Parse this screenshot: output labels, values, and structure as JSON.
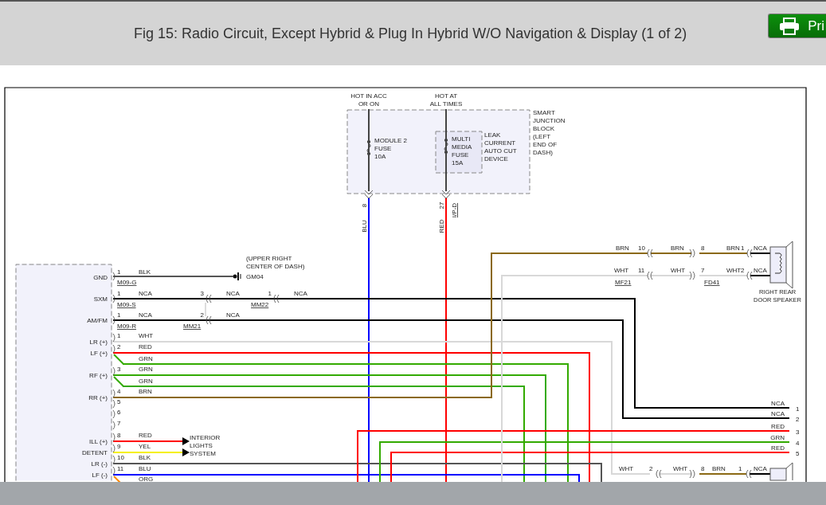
{
  "header": {
    "title": "Fig 15: Radio Circuit, Except Hybrid & Plug In Hybrid W/O Navigation & Display (1 of 2)",
    "print_button": "Pri"
  },
  "feeds": [
    {
      "label": [
        "HOT IN ACC",
        "OR ON"
      ],
      "fuse": [
        "MODULE 2",
        "FUSE",
        "10A"
      ],
      "pin": "8",
      "wire": "BLU",
      "color": "#0000ff"
    },
    {
      "label": [
        "HOT AT",
        "ALL TIMES"
      ],
      "fuse": [
        "MULTI",
        "MEDIA",
        "FUSE",
        "15A"
      ],
      "pin": "27",
      "wire": "RED",
      "color": "#ff0000",
      "connector": "I/P-D"
    }
  ],
  "junction_block": {
    "label": [
      "SMART",
      "JUNCTION",
      "BLOCK",
      "(LEFT",
      "END OF",
      "DASH)"
    ],
    "device": [
      "LEAK",
      "CURRENT",
      "AUTO CUT",
      "DEVICE"
    ]
  },
  "ground": {
    "label": "GND",
    "pin": "1",
    "wire": "BLK",
    "connector": "M09-G",
    "ground_point": "GM04",
    "note": [
      "(UPPER RIGHT",
      "CENTER OF DASH)"
    ]
  },
  "antenna_lines": [
    {
      "label": "SXM",
      "pin": "1",
      "wire": "NCA",
      "connector": "M09-S",
      "splices": [
        {
          "pin": "3",
          "wire": "NCA"
        },
        {
          "pin": "1",
          "wire": "NCA",
          "connector": "MM22"
        }
      ]
    },
    {
      "label": "AM/FM",
      "pin": "1",
      "wire": "NCA",
      "connector": "M09-R",
      "splices": [
        {
          "pin": "2",
          "wire": "NCA",
          "connector": "MM21"
        }
      ]
    }
  ],
  "pins": [
    {
      "number": "1",
      "label": "LR (+)",
      "wires": [
        {
          "label": "WHT",
          "color": "#d8d8d8"
        }
      ]
    },
    {
      "number": "2",
      "label": "LF (+)",
      "wires": [
        {
          "label": "RED",
          "color": "#ff0000"
        },
        {
          "label": "GRN",
          "color": "#33aa00"
        }
      ]
    },
    {
      "number": "3",
      "label": "RF (+)",
      "wires": [
        {
          "label": "GRN",
          "color": "#33aa00"
        },
        {
          "label": "GRN",
          "color": "#33aa00"
        }
      ]
    },
    {
      "number": "4",
      "label": "RR (+)",
      "wires": [
        {
          "label": "BRN",
          "color": "#8b6914"
        }
      ]
    },
    {
      "number": "5"
    },
    {
      "number": "6"
    },
    {
      "number": "7"
    },
    {
      "number": "8",
      "label": "ILL (+)",
      "wires": [
        {
          "label": "RED",
          "color": "#ff0000"
        }
      ]
    },
    {
      "number": "9",
      "label": "DETENT",
      "wires": [
        {
          "label": "YEL",
          "color": "#f5f000"
        }
      ]
    },
    {
      "number": "10",
      "label": "LR (-)",
      "wires": [
        {
          "label": "BLK",
          "color": "#555555"
        }
      ]
    },
    {
      "number": "11",
      "label": "LF (-)",
      "wires": [
        {
          "label": "BLU",
          "color": "#0000ff"
        },
        {
          "label": "ORG",
          "color": "#ff8800"
        }
      ]
    }
  ],
  "interior_lights": [
    "INTERIOR",
    "LIGHTS",
    "SYSTEM"
  ],
  "outputs": [
    {
      "wire": "NCA",
      "number": "1",
      "color": "#000000"
    },
    {
      "wire": "NCA",
      "number": "2",
      "color": "#000000"
    },
    {
      "wire": "RED",
      "number": "3",
      "color": "#ff0000"
    },
    {
      "wire": "GRN",
      "number": "4",
      "color": "#33aa00"
    },
    {
      "wire": "RED",
      "number": "5",
      "color": "#ff0000"
    }
  ],
  "speakers": [
    {
      "name": [
        "RIGHT REAR",
        "DOOR SPEAKER"
      ],
      "connectors": [
        "MF21",
        "FD41"
      ],
      "circuits": [
        {
          "segments": [
            {
              "label": "BRN",
              "color": "#8b6914"
            },
            {
              "label": "BRN",
              "color": "#8b6914"
            },
            {
              "label": "BRN",
              "color": "#8b6914"
            }
          ],
          "pins": [
            "10",
            "8",
            "1"
          ],
          "speaker_wire": "NCA"
        },
        {
          "segments": [
            {
              "label": "WHT",
              "color": "#d8d8d8"
            },
            {
              "label": "WHT",
              "color": "#d8d8d8"
            },
            {
              "label": "WHT",
              "color": "#d8d8d8"
            }
          ],
          "pins": [
            "11",
            "7",
            "2"
          ],
          "speaker_wire": "NCA"
        }
      ]
    },
    {
      "circuits": [
        {
          "segments": [
            {
              "label": "WHT",
              "color": "#d8d8d8"
            },
            {
              "label": "WHT",
              "color": "#d8d8d8"
            },
            {
              "label": "BRN",
              "color": "#8b6914"
            }
          ],
          "pins": [
            "2",
            "8",
            "1"
          ],
          "speaker_wire": "NCA"
        }
      ]
    }
  ]
}
